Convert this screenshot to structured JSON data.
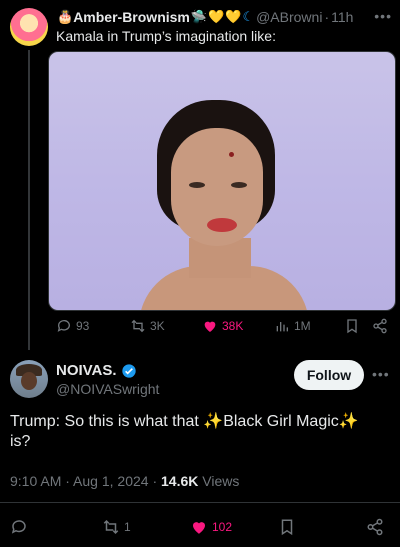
{
  "tweet1": {
    "display_name": "Amber-Brownism",
    "handle": "@ABrowni",
    "time": "11h",
    "text": "Kamala in Trump’s imagination like:",
    "stats": {
      "replies": "93",
      "reposts": "3K",
      "likes": "38K",
      "views": "1M"
    }
  },
  "tweet2": {
    "display_name": "NOIVAS.",
    "handle": "@NOIVASwright",
    "follow_label": "Follow",
    "text_part1": "Trump: So this is what that ",
    "text_part2": "Black Girl Magic",
    "text_part3": "is?",
    "time": "9:10 AM",
    "date": "Aug 1, 2024",
    "views_count": "14.6K",
    "views_label": "Views",
    "stats": {
      "reposts": "1",
      "likes": "102"
    }
  },
  "colors": {
    "like_pink": "#f91880",
    "verified_blue": "#1d9bf0",
    "muted": "#71767b"
  }
}
